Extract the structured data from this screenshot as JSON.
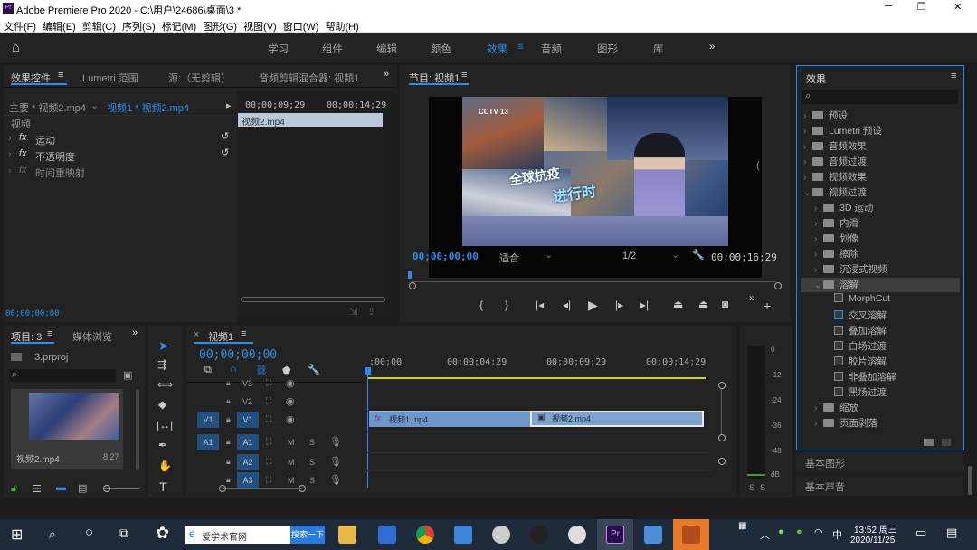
{
  "window": {
    "title": "Adobe Premiere Pro 2020 - C:\\用户\\24686\\桌面\\3 *"
  },
  "menu": [
    "文件(F)",
    "编辑(E)",
    "剪辑(C)",
    "序列(S)",
    "标记(M)",
    "图形(G)",
    "视图(V)",
    "窗口(W)",
    "帮助(H)"
  ],
  "workspaces": [
    "学习",
    "组件",
    "编辑",
    "颜色",
    "效果",
    "音频",
    "图形",
    "库"
  ],
  "effect_controls": {
    "tabs": [
      "效果控件",
      "Lumetri 范围",
      "源:（无剪辑）",
      "音频剪辑混合器: 视频1"
    ],
    "master": "主要 * 视频2.mp4",
    "sequence": "视频1 * 视频2.mp4",
    "tc1": "00;00;09;29",
    "tc2": "00;00;14;29",
    "clip": "视频2.mp4",
    "section": "视频",
    "rows": [
      "运动",
      "不透明度",
      "时间重映射"
    ],
    "footer_tc": "00;00;00;00"
  },
  "program": {
    "title": "节目: 视频1",
    "tc_left": "00;00;00;00",
    "fit": "适合",
    "ratio": "1/2",
    "tc_right": "00;00;16;29",
    "video_logo": "CCTV 13",
    "video_caption1": "全球抗疫",
    "video_caption2": "进行时"
  },
  "effects_panel": {
    "title": "效果",
    "items": [
      {
        "label": "预设",
        "indent": 0,
        "type": "folder",
        "chev": "›"
      },
      {
        "label": "Lumetri 预设",
        "indent": 0,
        "type": "folder",
        "chev": "›"
      },
      {
        "label": "音频效果",
        "indent": 0,
        "type": "folder",
        "chev": "›"
      },
      {
        "label": "音频过渡",
        "indent": 0,
        "type": "folder",
        "chev": "›"
      },
      {
        "label": "视频效果",
        "indent": 0,
        "type": "folder",
        "chev": "›"
      },
      {
        "label": "视频过渡",
        "indent": 0,
        "type": "folder",
        "chev": "⌄"
      },
      {
        "label": "3D 运动",
        "indent": 1,
        "type": "folder",
        "chev": "›"
      },
      {
        "label": "内滑",
        "indent": 1,
        "type": "folder",
        "chev": "›"
      },
      {
        "label": "划像",
        "indent": 1,
        "type": "folder",
        "chev": "›"
      },
      {
        "label": "擦除",
        "indent": 1,
        "type": "folder",
        "chev": "›"
      },
      {
        "label": "沉浸式视频",
        "indent": 1,
        "type": "folder",
        "chev": "›"
      },
      {
        "label": "溶解",
        "indent": 1,
        "type": "folder",
        "chev": "⌄"
      },
      {
        "label": "MorphCut",
        "indent": 2,
        "type": "fx",
        "chev": ""
      },
      {
        "label": "交叉溶解",
        "indent": 2,
        "type": "fx",
        "chev": ""
      },
      {
        "label": "叠加溶解",
        "indent": 2,
        "type": "fx",
        "chev": ""
      },
      {
        "label": "白场过渡",
        "indent": 2,
        "type": "fx",
        "chev": ""
      },
      {
        "label": "胶片溶解",
        "indent": 2,
        "type": "fx",
        "chev": ""
      },
      {
        "label": "非叠加溶解",
        "indent": 2,
        "type": "fx",
        "chev": ""
      },
      {
        "label": "黑场过渡",
        "indent": 2,
        "type": "fx",
        "chev": ""
      },
      {
        "label": "缩放",
        "indent": 1,
        "type": "folder",
        "chev": "›"
      },
      {
        "label": "页面剥落",
        "indent": 1,
        "type": "folder",
        "chev": "›"
      }
    ],
    "basic_graphics": "基本图形",
    "basic_sound": "基本声音"
  },
  "project": {
    "tabs": [
      "项目: 3",
      "媒体浏览"
    ],
    "file": "3.prproj",
    "clip": "视频2.mp4",
    "duration": "8;27"
  },
  "timeline": {
    "title": "视频1",
    "tc": "00;00;00;00",
    "ruler": [
      ":00;00",
      "00;00;04;29",
      "00;00;09;29",
      "00;00;14;29"
    ],
    "tracks": [
      "V3",
      "V2",
      "V1",
      "A1",
      "A2",
      "A3"
    ],
    "src_v": "V1",
    "src_a": "A1",
    "clip1": "视频1.mp4",
    "clip2": "视频2.mp4",
    "mute": "M",
    "solo": "S"
  },
  "meter": {
    "ticks": [
      "0",
      "-12",
      "-24",
      "-36",
      "-48",
      "dB"
    ],
    "solo": "S"
  },
  "taskbar": {
    "search_text": "爱学术官网",
    "search_btn": "搜索一下",
    "time": "13:52 周三",
    "date": "2020/11/25",
    "ime": "中"
  },
  "colors": {
    "accent": "#2d8ceb",
    "clip": "#6f96c8"
  }
}
